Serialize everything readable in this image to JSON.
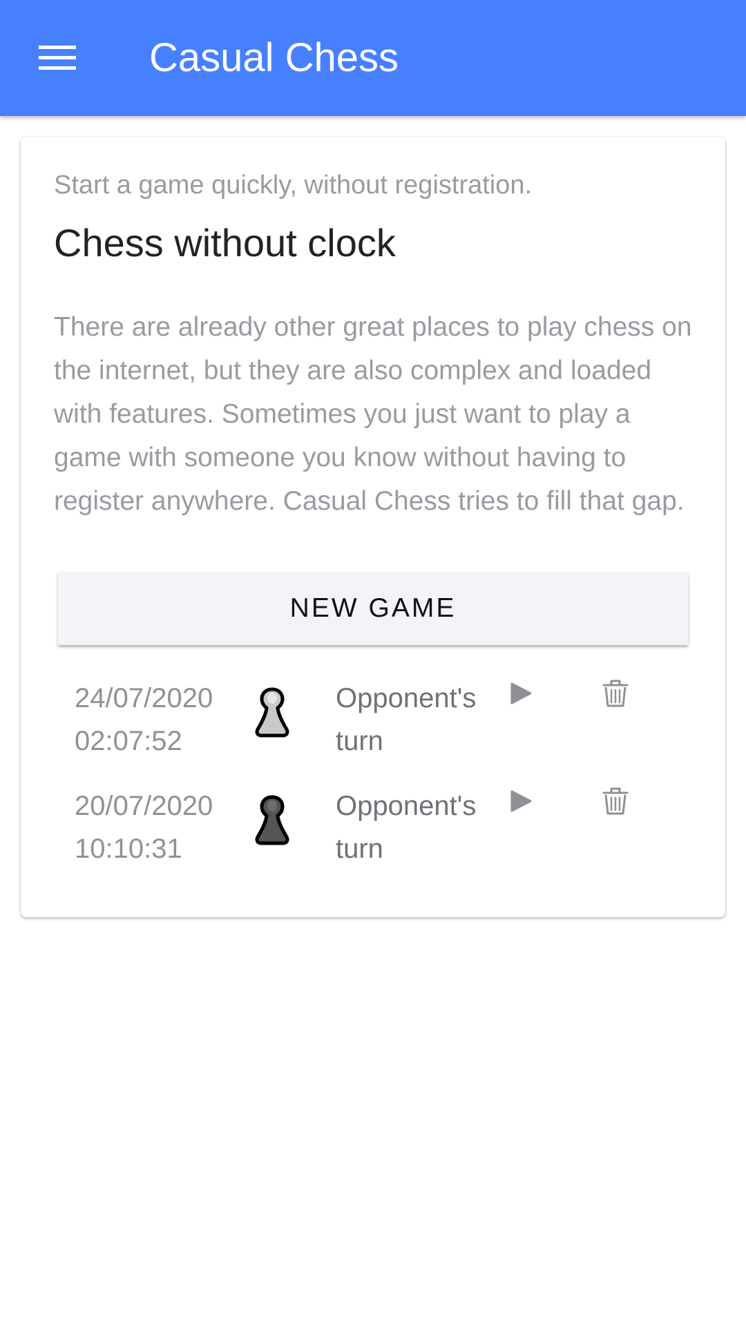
{
  "appbar": {
    "title": "Casual Chess",
    "menu_icon": "hamburger-menu-icon",
    "color": "#4680ff"
  },
  "card": {
    "overline": "Start a game quickly, without registration.",
    "title": "Chess without clock",
    "description": "There are already other great places to play chess on the internet, but they are also complex and loaded with features. Sometimes you just want to play a game with someone you know without having to register anywhere. Casual Chess tries to fill that gap.",
    "new_game_label": "NEW GAME"
  },
  "games": [
    {
      "date": "24/07/2020",
      "time": "02:07:52",
      "piece": "white-pawn-icon",
      "status_line1": "Opponent's",
      "status_line2": "turn",
      "play_icon": "play-icon",
      "delete_icon": "trash-icon"
    },
    {
      "date": "20/07/2020",
      "time": "10:10:31",
      "piece": "black-pawn-icon",
      "status_line1": "Opponent's",
      "status_line2": "turn",
      "play_icon": "play-icon",
      "delete_icon": "trash-icon"
    }
  ]
}
